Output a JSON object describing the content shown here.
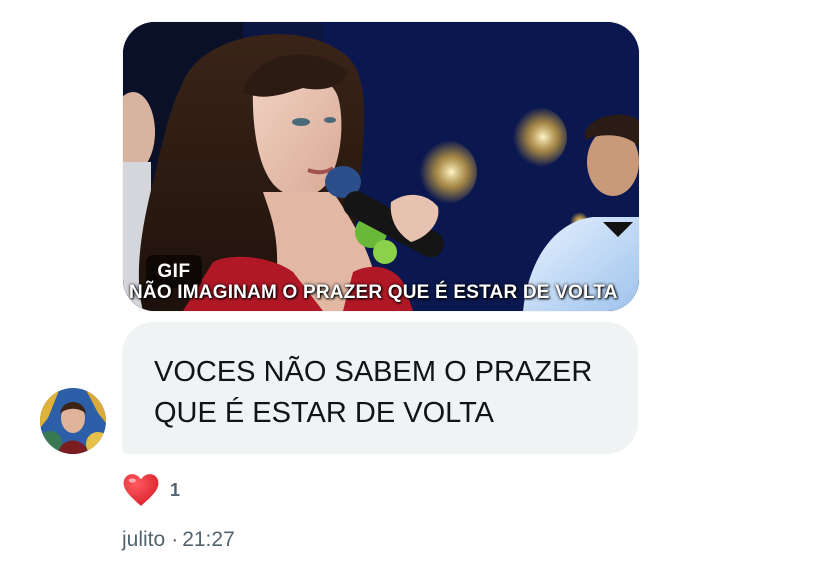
{
  "gif": {
    "badge": "GIF",
    "caption": "NÃO IMAGINAM O PRAZER QUE É ESTAR DE VOLTA"
  },
  "message": {
    "text": "VOCES NÃO SABEM O PRAZER QUE É ESTAR DE VOLTA"
  },
  "reaction": {
    "icon": "heart-icon",
    "count": "1",
    "color": "#e0245e"
  },
  "meta": {
    "sender": "julito",
    "separator": "·",
    "time": "21:27"
  },
  "colors": {
    "bubble": "#eff3f4",
    "text": "#0f1419",
    "secondary": "#536471"
  }
}
